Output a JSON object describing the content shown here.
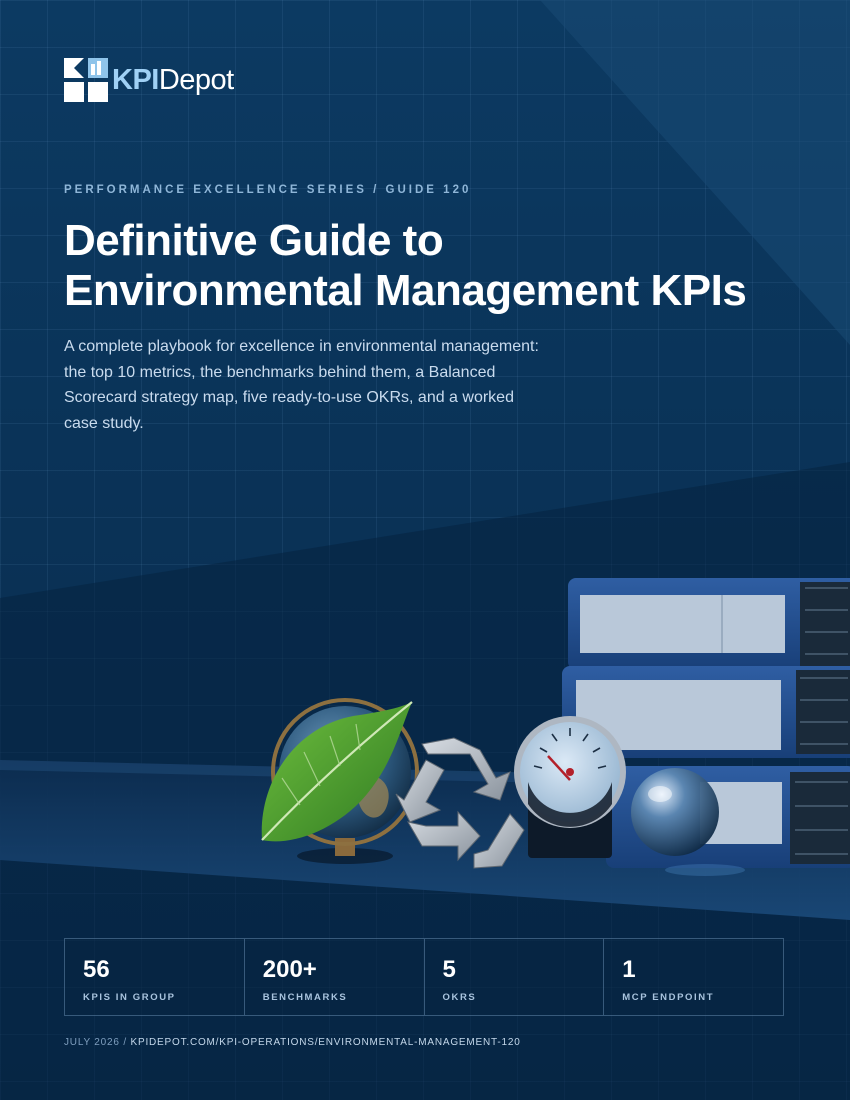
{
  "brand": {
    "strong": "KPI",
    "light": "Depot",
    "logo_icon": "kpidepot-logo-icon"
  },
  "series_label": "PERFORMANCE EXCELLENCE SERIES / GUIDE 120",
  "title": {
    "line1": "Definitive Guide to",
    "line2": "Environmental Management KPIs"
  },
  "subtitle": "A complete playbook for excellence in environmental management: the top 10 metrics, the benchmarks behind them, a Balanced Scorecard strategy map, five ready-to-use OKRs, and a worked case study.",
  "stats": [
    {
      "value": "56",
      "label": "KPIS IN GROUP"
    },
    {
      "value": "200+",
      "label": "BENCHMARKS"
    },
    {
      "value": "5",
      "label": "OKRS"
    },
    {
      "value": "1",
      "label": "MCP ENDPOINT"
    }
  ],
  "footer": {
    "date": "JULY 2026",
    "separator": " / ",
    "url": "KPIDEPOT.COM/KPI-OPERATIONS/ENVIRONMENTAL-MANAGEMENT-120"
  },
  "colors": {
    "background": "#0a3358",
    "accent": "#9fd0f5",
    "text": "#ffffff",
    "muted": "#a9c4de"
  },
  "illustration": {
    "icons": [
      "binder-icon",
      "globe-icon",
      "leaf-icon",
      "recycle-icon",
      "gauge-icon",
      "glass-sphere-icon"
    ]
  }
}
